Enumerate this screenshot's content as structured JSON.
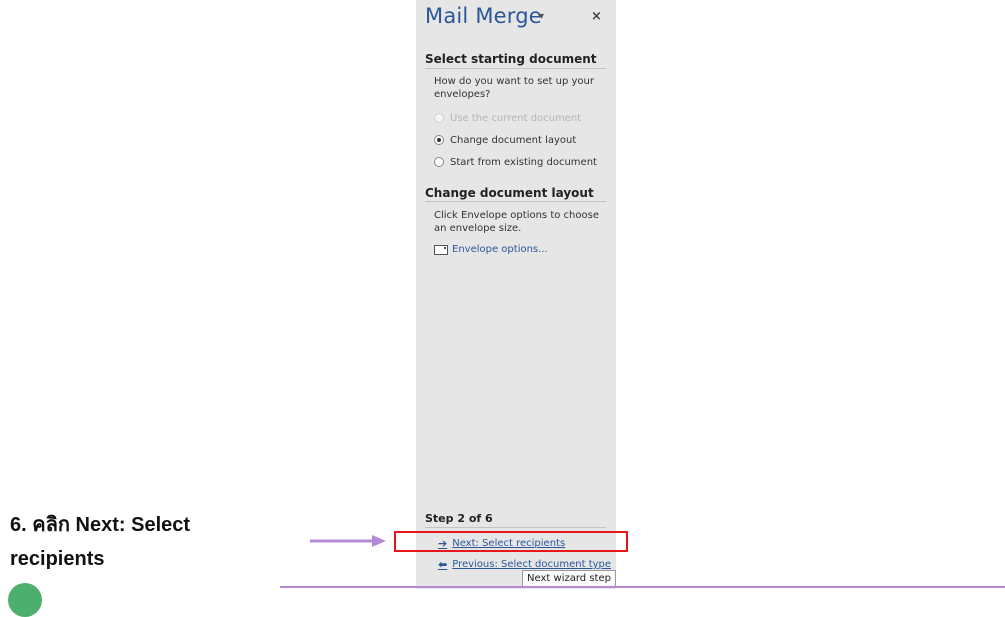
{
  "pane": {
    "title": "Mail Merge",
    "dropdown_glyph": "▾",
    "close_glyph": "×"
  },
  "section1": {
    "title": "Select starting document",
    "prompt": "How do you want to set up your envelopes?",
    "options": [
      {
        "label": "Use the current document",
        "state": "disabled"
      },
      {
        "label": "Change document layout",
        "state": "selected"
      },
      {
        "label": "Start from existing document",
        "state": "unselected"
      }
    ]
  },
  "section2": {
    "title": "Change document layout",
    "description": "Click Envelope options to choose an envelope size.",
    "link_label": "Envelope options..."
  },
  "footer": {
    "step_label": "Step 2 of 6",
    "next_label": "Next: Select recipients",
    "previous_label": "Previous: Select document type",
    "tooltip": "Next wizard step"
  },
  "instruction": {
    "line1": "6. คลิก Next: Select",
    "line2": "recipients"
  },
  "icons": [
    "dropdown-icon",
    "close-icon",
    "envelope-icon",
    "arrow-right-icon",
    "arrow-left-icon",
    "pointer-arrow-icon"
  ],
  "colors": {
    "accent": "#2b579a",
    "highlight": "#e8161c",
    "annotation_arrow": "#b48ad6",
    "pane_bg": "#e6e6e6"
  }
}
